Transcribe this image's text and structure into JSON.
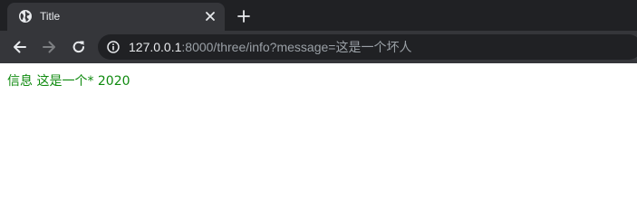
{
  "tab": {
    "title": "Title",
    "favicon_icon": "globe-icon",
    "close_icon": "close-icon"
  },
  "tab_strip": {
    "new_tab_icon": "plus-icon"
  },
  "toolbar": {
    "back_icon": "arrow-left-icon",
    "forward_icon": "arrow-right-icon",
    "reload_icon": "reload-icon",
    "site_info_icon": "info-icon"
  },
  "address_bar": {
    "host": "127.0.0.1",
    "rest": ":8000/three/info?message=这是一个坏人"
  },
  "content": {
    "message_text": "信息 这是一个* 2020",
    "text_color": "#0f8a0f"
  },
  "colors": {
    "tab_strip_bg": "#202124",
    "toolbar_bg": "#35363a",
    "omnibox_bg": "#202124"
  }
}
